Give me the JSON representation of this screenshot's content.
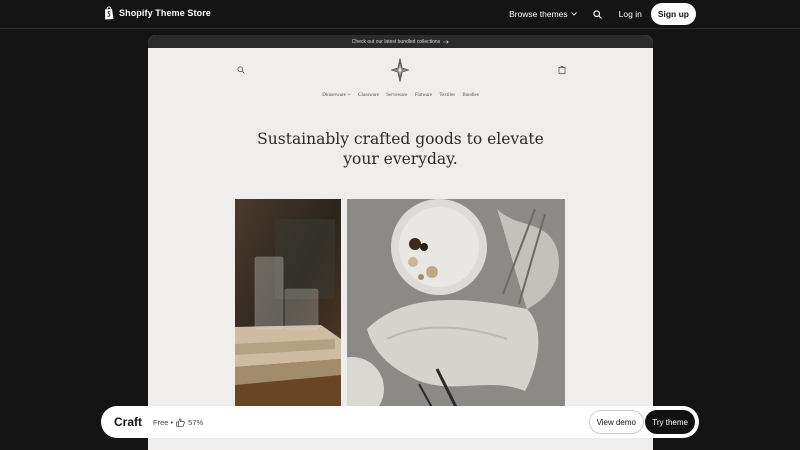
{
  "nav": {
    "brand": "Shopify Theme Store",
    "browse": "Browse themes",
    "login": "Log in",
    "signup": "Sign up"
  },
  "preview": {
    "announcement": "Check out our latest bundled collections",
    "menu": [
      "Dinnerware",
      "Glassware",
      "Serveware",
      "Flatware",
      "Textiles",
      "Bundles"
    ],
    "hero_line1": "Sustainably crafted goods to elevate",
    "hero_line2": "your everyday."
  },
  "theme_bar": {
    "name": "Craft",
    "price": "Free •",
    "rating": "57%",
    "view_demo": "View demo",
    "try_theme": "Try theme"
  },
  "colors": {
    "page_bg": "#141414",
    "preview_bg": "#efeeec",
    "announce_bg": "#2b2b2b",
    "button_dark": "#111111"
  },
  "icons": [
    "shopify-bag-icon",
    "chevron-down-icon",
    "search-icon",
    "arrow-right-icon",
    "diamond-star-logo",
    "cart-icon",
    "thumbs-up-icon"
  ]
}
